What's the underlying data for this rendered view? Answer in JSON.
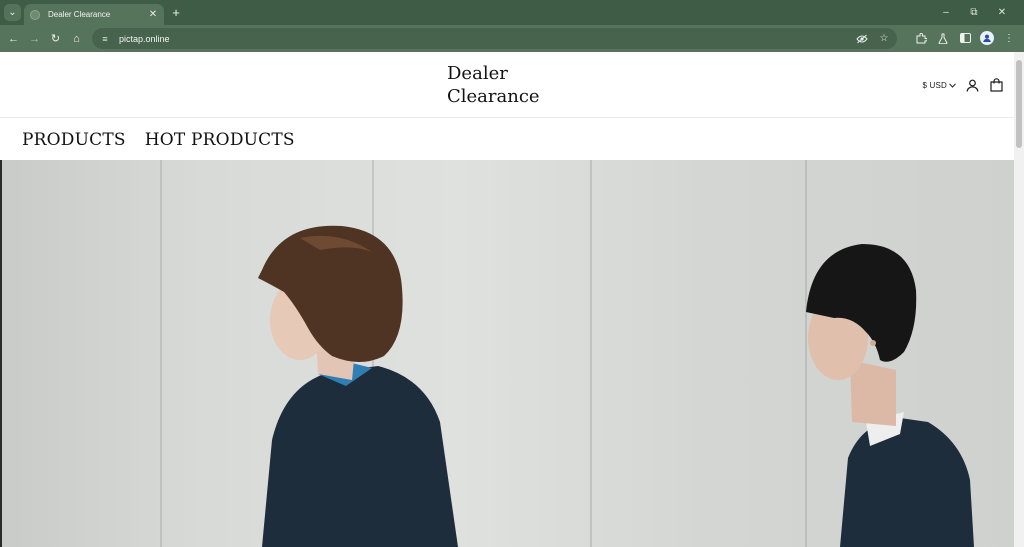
{
  "browser": {
    "tab_title": "Dealer Clearance",
    "url": "pictap.online",
    "icons": {
      "tab_list": "chevron-down-icon",
      "tab_close": "close-icon",
      "new_tab": "plus-icon",
      "minimize": "minimize-icon",
      "restore": "restore-icon",
      "window_close": "close-icon",
      "back": "arrow-left-icon",
      "forward": "arrow-right-icon",
      "reload": "reload-icon",
      "home": "home-icon",
      "site_info": "tune-icon",
      "eye_off": "eye-off-icon",
      "bookmark": "star-icon",
      "extensions": "puzzle-icon",
      "labs": "flask-icon",
      "side_panel": "side-panel-icon",
      "profile": "account-circle-icon",
      "menu": "more-vert-icon"
    },
    "colors": {
      "tabbar": "#3f5c46",
      "toolbar": "#56735c"
    }
  },
  "site": {
    "logo_line1": "Dealer",
    "logo_line2": "Clearance",
    "currency": "$ USD",
    "icons": {
      "account": "user-icon",
      "cart": "shopping-bag-icon"
    },
    "nav": [
      {
        "label": "PRODUCTS"
      },
      {
        "label": "HOT PRODUCTS"
      }
    ]
  },
  "hero": {
    "description_icon": "hero-image"
  }
}
